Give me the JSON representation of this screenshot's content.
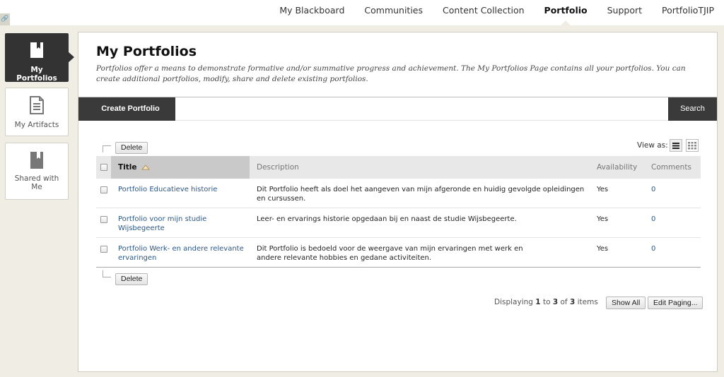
{
  "nav": {
    "items": [
      {
        "label": "My Blackboard",
        "active": false
      },
      {
        "label": "Communities",
        "active": false
      },
      {
        "label": "Content Collection",
        "active": false
      },
      {
        "label": "Portfolio",
        "active": true
      },
      {
        "label": "Support",
        "active": false
      },
      {
        "label": "PortfolioTJIP",
        "active": false
      }
    ]
  },
  "sidebar": {
    "items": [
      {
        "label": "My Portfolios",
        "icon": "portfolio-book-icon",
        "active": true
      },
      {
        "label": "My Artifacts",
        "icon": "document-icon",
        "active": false
      },
      {
        "label": "Shared with Me",
        "icon": "shared-book-icon",
        "active": false
      }
    ]
  },
  "page": {
    "title": "My Portfolios",
    "intro": "Portfolios offer a means to demonstrate formative and/or summative progress and achievement. The My Portfolios Page contains all your portfolios. You can create additional portfolios, modify, share and delete existing portfolios."
  },
  "toolbar": {
    "create_label": "Create Portfolio",
    "search_label": "Search",
    "delete_label": "Delete",
    "view_as_label": "View as:"
  },
  "table": {
    "columns": {
      "title": "Title",
      "description": "Description",
      "availability": "Availability",
      "comments": "Comments"
    },
    "rows": [
      {
        "title": "Portfolio Educatieve historie",
        "description": "Dit Portfolio heeft als doel het aangeven van mijn afgeronde en huidig gevolgde opleidingen en cursussen.",
        "availability": "Yes",
        "comments": "0"
      },
      {
        "title": "Portfolio voor mijn studie Wijsbegeerte",
        "description": "Leer- en ervarings historie opgedaan bij en naast de studie Wijsbegeerte.",
        "availability": "Yes",
        "comments": "0"
      },
      {
        "title": "Portfolio Werk- en andere relevante ervaringen",
        "description": "Dit Portfolio is bedoeld voor de weergave van mijn ervaringen met werk en andere relevante hobbies en gedane activiteiten.",
        "availability": "Yes",
        "comments": "0"
      }
    ]
  },
  "paging": {
    "prefix": "Displaying",
    "start": "1",
    "to": "to",
    "end": "3",
    "of": "of",
    "total": "3",
    "suffix": "items",
    "show_all_label": "Show All",
    "edit_paging_label": "Edit Paging..."
  },
  "colors": {
    "accent_dark": "#3a3a3a",
    "link": "#2b5888",
    "page_bg": "#efede4"
  }
}
